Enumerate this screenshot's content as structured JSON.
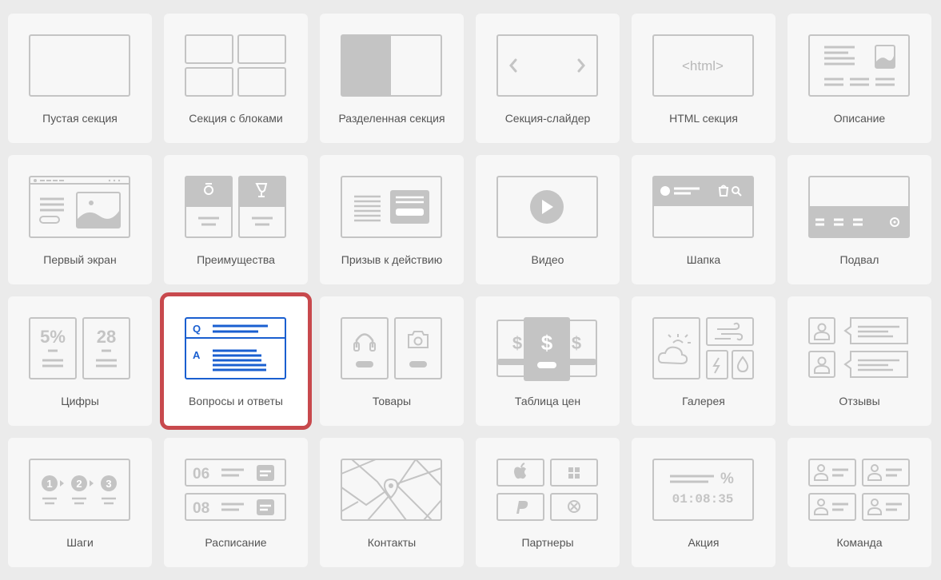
{
  "accent_color": "#1a5fd0",
  "selection_color": "#c8494d",
  "icon_color": "#c4c4c4",
  "selected_item": "Вопросы и ответы",
  "sections": [
    {
      "label": "Пустая секция",
      "icon": "empty-section-icon"
    },
    {
      "label": "Секция с блоками",
      "icon": "blocks-section-icon"
    },
    {
      "label": "Разделенная секция",
      "icon": "split-section-icon"
    },
    {
      "label": "Секция-слайдер",
      "icon": "slider-section-icon"
    },
    {
      "label": "HTML секция",
      "icon": "html-section-icon",
      "icon_text": "<html>"
    },
    {
      "label": "Описание",
      "icon": "description-icon"
    },
    {
      "label": "Первый экран",
      "icon": "first-screen-icon"
    },
    {
      "label": "Преимущества",
      "icon": "advantages-icon"
    },
    {
      "label": "Призыв к действию",
      "icon": "call-to-action-icon"
    },
    {
      "label": "Видео",
      "icon": "video-icon"
    },
    {
      "label": "Шапка",
      "icon": "header-icon"
    },
    {
      "label": "Подвал",
      "icon": "footer-icon"
    },
    {
      "label": "Цифры",
      "icon": "numbers-icon",
      "icon_text": [
        "5%",
        "28"
      ]
    },
    {
      "label": "Вопросы и ответы",
      "icon": "faq-icon",
      "icon_text": [
        "Q",
        "A"
      ]
    },
    {
      "label": "Товары",
      "icon": "products-icon"
    },
    {
      "label": "Таблица цен",
      "icon": "price-table-icon",
      "icon_text": [
        "$",
        "$",
        "$"
      ]
    },
    {
      "label": "Галерея",
      "icon": "gallery-icon"
    },
    {
      "label": "Отзывы",
      "icon": "reviews-icon"
    },
    {
      "label": "Шаги",
      "icon": "steps-icon",
      "icon_text": [
        "1",
        "2",
        "3"
      ]
    },
    {
      "label": "Расписание",
      "icon": "schedule-icon",
      "icon_text": [
        "06",
        "08"
      ]
    },
    {
      "label": "Контакты",
      "icon": "contacts-icon"
    },
    {
      "label": "Партнеры",
      "icon": "partners-icon"
    },
    {
      "label": "Акция",
      "icon": "promo-icon",
      "icon_text": [
        "%",
        "01:08:35"
      ]
    },
    {
      "label": "Команда",
      "icon": "team-icon"
    }
  ]
}
